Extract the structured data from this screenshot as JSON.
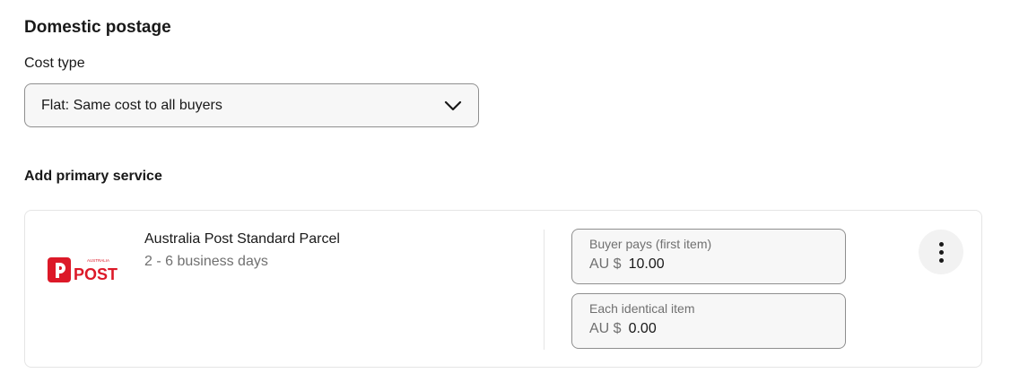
{
  "domestic_postage": {
    "title": "Domestic postage",
    "cost_type_label": "Cost type",
    "cost_type_selected": "Flat: Same cost to all buyers"
  },
  "primary_service": {
    "title": "Add primary service",
    "service_name": "Australia Post Standard Parcel",
    "delivery_time": "2 - 6 business days",
    "logo": {
      "icon": "australia-post-logo",
      "small_text": "AUSTRALIA",
      "text": "POST",
      "color": "#dc1928"
    },
    "buyer_pays": {
      "label": "Buyer pays (first item)",
      "currency": "AU $",
      "value": "10.00"
    },
    "each_identical": {
      "label": "Each identical item",
      "currency": "AU $",
      "value": "0.00"
    },
    "more_icon": "more-vertical-icon"
  }
}
